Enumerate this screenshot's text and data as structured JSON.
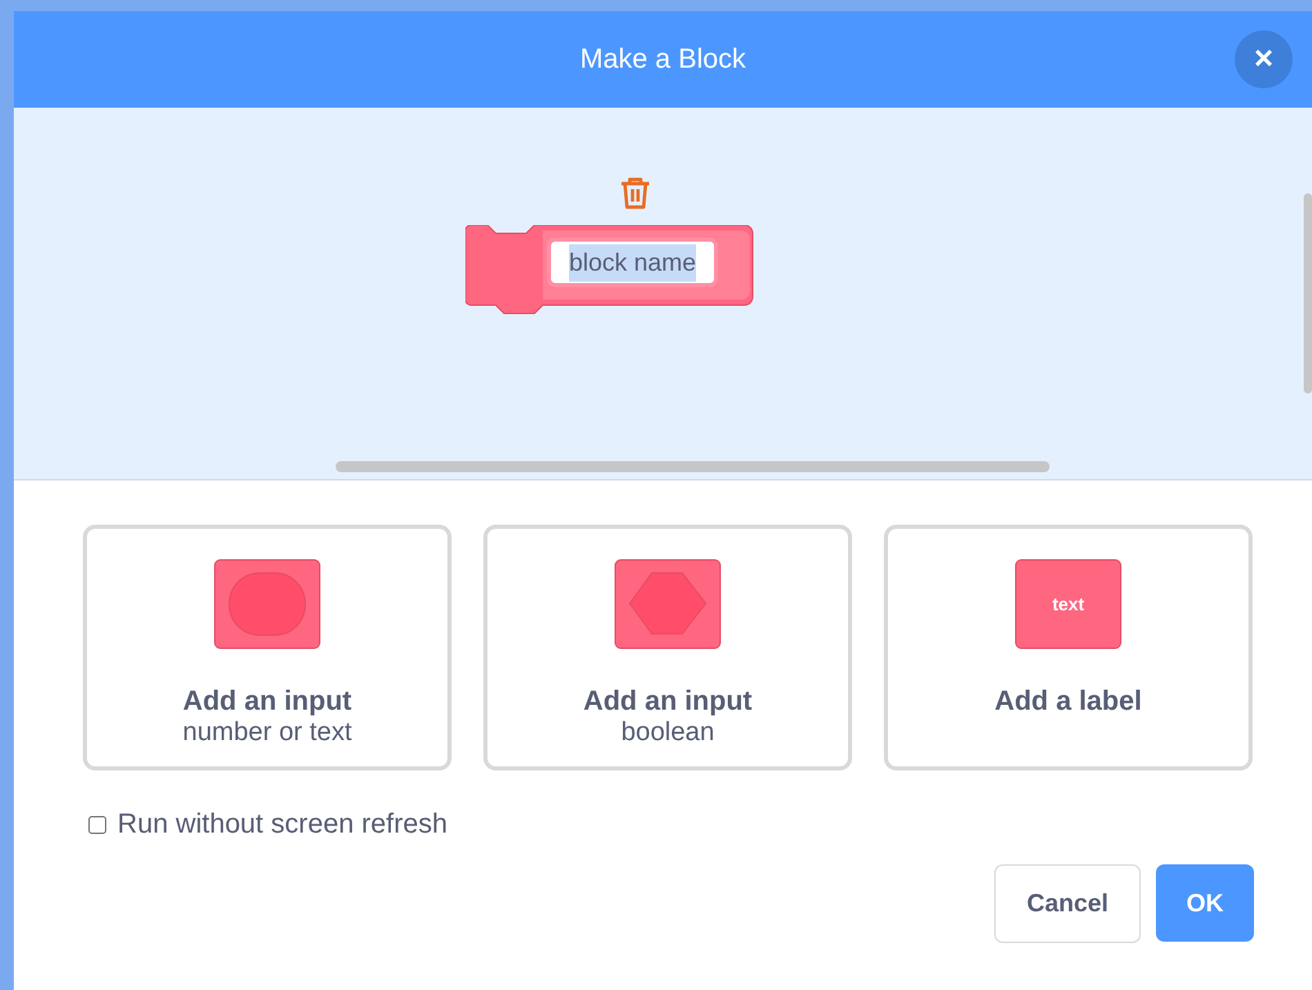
{
  "window": {
    "title": "Make a Block",
    "close_label": "×"
  },
  "preview": {
    "block_name": {
      "value": "block name",
      "text_selected": true
    }
  },
  "options": [
    {
      "kind": "number",
      "title": "Add an input",
      "subtitle": "number or text"
    },
    {
      "kind": "boolean",
      "title": "Add an input",
      "subtitle": "boolean"
    },
    {
      "kind": "label",
      "icon_text": "text",
      "title": "Add a label"
    }
  ],
  "run_without_refresh": {
    "label": "Run without screen refresh",
    "checked": false
  },
  "buttons": [
    {
      "kind": "secondary",
      "label": "Cancel"
    },
    {
      "kind": "primary",
      "label": "OK"
    }
  ]
}
